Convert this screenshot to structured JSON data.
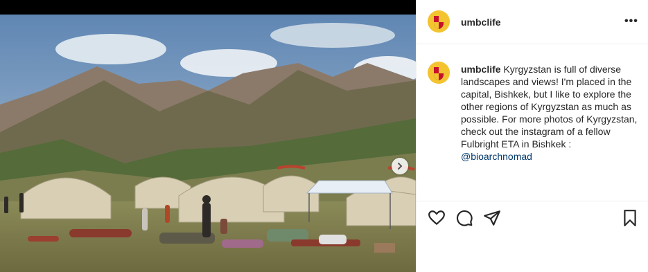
{
  "post": {
    "username": "umbclife",
    "more_options": "•••",
    "caption": {
      "username": "umbclife",
      "text": "Kyrgyzstan is full of diverse landscapes and views! I'm placed in the capital, Bishkek, but I like to explore the other regions of Kyrgyzstan as much as possible. For more photos of Kyrgyzstan, check out the instagram of a fellow Fulbright ETA in Bishkek :",
      "mention": "@bioarchnomad"
    }
  },
  "icons": {
    "like": "heart-icon",
    "comment": "comment-icon",
    "share": "paper-plane-icon",
    "save": "bookmark-icon",
    "next": "chevron-right-icon",
    "more": "more-horizontal-icon"
  },
  "colors": {
    "text": "#262626",
    "mention": "#00376b",
    "avatar_gold": "#f4c430",
    "avatar_red": "#c8102e",
    "border": "#efefef"
  }
}
